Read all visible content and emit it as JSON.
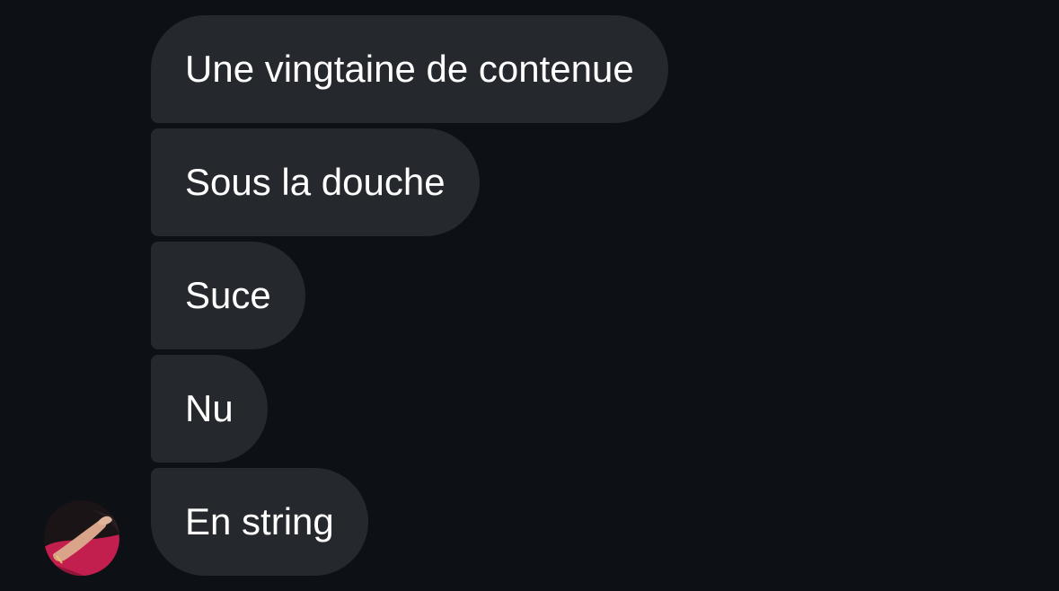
{
  "colors": {
    "background": "#0d1014",
    "bubble": "#25282d",
    "text": "#ffffff"
  },
  "messages": [
    {
      "text": "Une vingtaine de contenue"
    },
    {
      "text": "Sous la douche"
    },
    {
      "text": "Suce"
    },
    {
      "text": "Nu"
    },
    {
      "text": "En string"
    }
  ],
  "sender": {
    "avatar_icon": "profile-photo-avatar"
  }
}
